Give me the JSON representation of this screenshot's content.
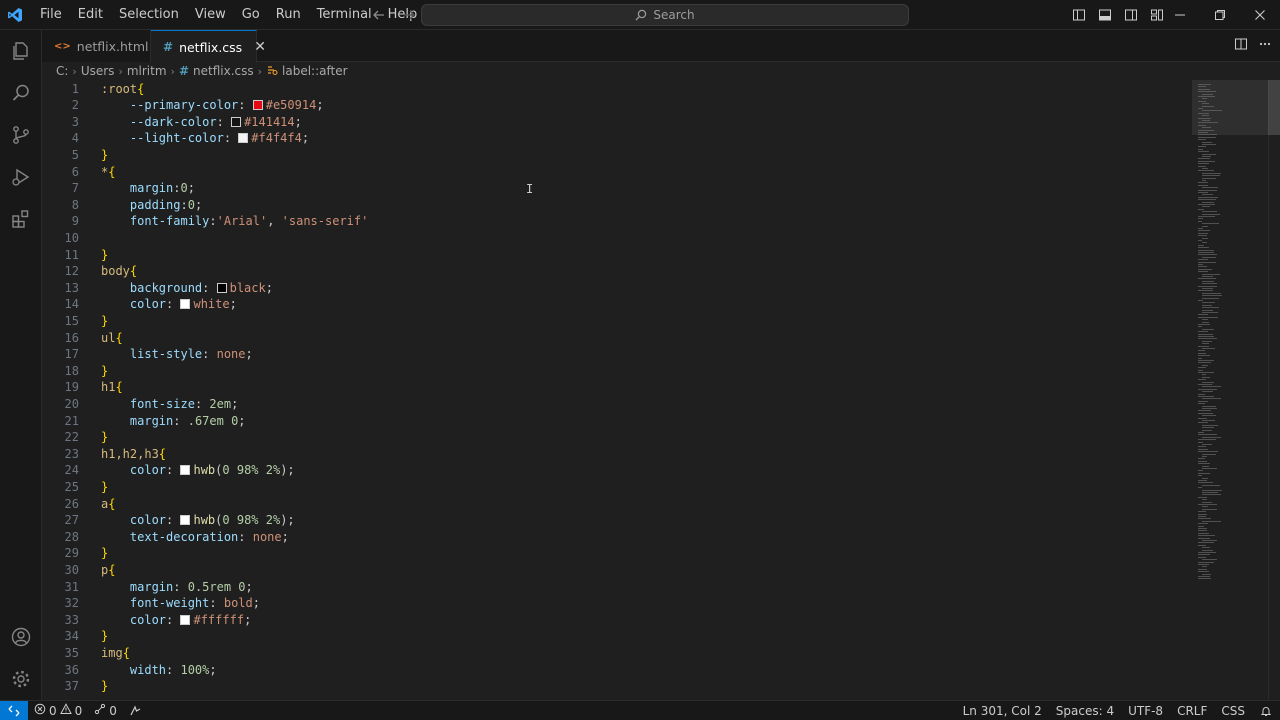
{
  "menu": [
    "File",
    "Edit",
    "Selection",
    "View",
    "Go",
    "Run",
    "Terminal",
    "Help"
  ],
  "search": {
    "label": "Search"
  },
  "tabs": [
    {
      "label": "netflix.html",
      "active": false
    },
    {
      "label": "netflix.css",
      "active": true
    }
  ],
  "breadcrumb": {
    "drive": "C:",
    "users": "Users",
    "user": "mlritm",
    "file": "netflix.css",
    "symbol": "label::after"
  },
  "code_lines": [
    {
      "n": "1",
      "tokens": [
        [
          "sel",
          ":root"
        ],
        [
          "brace",
          "{"
        ]
      ]
    },
    {
      "n": "2",
      "tokens": [
        [
          "sp",
          "    "
        ],
        [
          "var",
          "--primary-color"
        ],
        [
          "punc",
          ": "
        ],
        [
          "swatch",
          "#e50914"
        ],
        [
          "val",
          "#e50914"
        ],
        [
          "punc",
          ";"
        ]
      ]
    },
    {
      "n": "3",
      "tokens": [
        [
          "sp",
          "    "
        ],
        [
          "var",
          "--dark-color"
        ],
        [
          "punc",
          ": "
        ],
        [
          "swatch",
          "#141414"
        ],
        [
          "val",
          "#141414"
        ],
        [
          "punc",
          ";"
        ]
      ]
    },
    {
      "n": "4",
      "tokens": [
        [
          "sp",
          "    "
        ],
        [
          "var",
          "--light-color"
        ],
        [
          "punc",
          ": "
        ],
        [
          "swatch",
          "#f4f4f4"
        ],
        [
          "val",
          "#f4f4f4"
        ],
        [
          "punc",
          ";"
        ]
      ]
    },
    {
      "n": "5",
      "tokens": [
        [
          "brace",
          "}"
        ]
      ]
    },
    {
      "n": "6",
      "tokens": [
        [
          "sel",
          "*"
        ],
        [
          "brace",
          "{"
        ]
      ]
    },
    {
      "n": "7",
      "tokens": [
        [
          "sp",
          "    "
        ],
        [
          "prop",
          "margin"
        ],
        [
          "punc",
          ":"
        ],
        [
          "num",
          "0"
        ],
        [
          "punc",
          ";"
        ]
      ]
    },
    {
      "n": "8",
      "tokens": [
        [
          "sp",
          "    "
        ],
        [
          "prop",
          "padding"
        ],
        [
          "punc",
          ":"
        ],
        [
          "num",
          "0"
        ],
        [
          "punc",
          ";"
        ]
      ]
    },
    {
      "n": "9",
      "tokens": [
        [
          "sp",
          "    "
        ],
        [
          "prop",
          "font-family"
        ],
        [
          "punc",
          ":"
        ],
        [
          "val",
          "'Arial'"
        ],
        [
          "punc",
          ", "
        ],
        [
          "val",
          "'sans-serif'"
        ]
      ]
    },
    {
      "n": "10",
      "tokens": []
    },
    {
      "n": "11",
      "tokens": [
        [
          "brace",
          "}"
        ]
      ]
    },
    {
      "n": "12",
      "tokens": [
        [
          "sel",
          "body"
        ],
        [
          "brace",
          "{"
        ]
      ]
    },
    {
      "n": "13",
      "tokens": [
        [
          "sp",
          "    "
        ],
        [
          "prop",
          "background"
        ],
        [
          "punc",
          ": "
        ],
        [
          "swatch",
          "#000000"
        ],
        [
          "val",
          "black"
        ],
        [
          "punc",
          ";"
        ]
      ]
    },
    {
      "n": "14",
      "tokens": [
        [
          "sp",
          "    "
        ],
        [
          "prop",
          "color"
        ],
        [
          "punc",
          ": "
        ],
        [
          "swatch",
          "#ffffff"
        ],
        [
          "val",
          "white"
        ],
        [
          "punc",
          ";"
        ]
      ]
    },
    {
      "n": "15",
      "tokens": [
        [
          "brace",
          "}"
        ]
      ]
    },
    {
      "n": "16",
      "tokens": [
        [
          "sel",
          "ul"
        ],
        [
          "brace",
          "{"
        ]
      ]
    },
    {
      "n": "17",
      "tokens": [
        [
          "sp",
          "    "
        ],
        [
          "prop",
          "list-style"
        ],
        [
          "punc",
          ": "
        ],
        [
          "val",
          "none"
        ],
        [
          "punc",
          ";"
        ]
      ]
    },
    {
      "n": "18",
      "tokens": [
        [
          "brace",
          "}"
        ]
      ]
    },
    {
      "n": "19",
      "tokens": [
        [
          "sel",
          "h1"
        ],
        [
          "brace",
          "{"
        ]
      ]
    },
    {
      "n": "20",
      "tokens": [
        [
          "sp",
          "    "
        ],
        [
          "prop",
          "font-size"
        ],
        [
          "punc",
          ": "
        ],
        [
          "num",
          "2em"
        ],
        [
          "punc",
          ";"
        ]
      ]
    },
    {
      "n": "21",
      "tokens": [
        [
          "sp",
          "    "
        ],
        [
          "prop",
          "margin"
        ],
        [
          "punc",
          ": "
        ],
        [
          "num",
          ".67em 0"
        ],
        [
          "punc",
          ";"
        ]
      ]
    },
    {
      "n": "22",
      "tokens": [
        [
          "brace",
          "}"
        ]
      ]
    },
    {
      "n": "23",
      "tokens": [
        [
          "sel",
          "h1,h2,h3"
        ],
        [
          "brace",
          "{"
        ]
      ]
    },
    {
      "n": "24",
      "tokens": [
        [
          "sp",
          "    "
        ],
        [
          "prop",
          "color"
        ],
        [
          "punc",
          ": "
        ],
        [
          "swatch",
          "#ffffff"
        ],
        [
          "fn",
          "hwb"
        ],
        [
          "punc",
          "("
        ],
        [
          "num",
          "0 98% 2%"
        ],
        [
          "punc",
          ");"
        ]
      ]
    },
    {
      "n": "25",
      "tokens": [
        [
          "brace",
          "}"
        ]
      ]
    },
    {
      "n": "26",
      "tokens": [
        [
          "sel",
          "a"
        ],
        [
          "brace",
          "{"
        ]
      ]
    },
    {
      "n": "27",
      "tokens": [
        [
          "sp",
          "    "
        ],
        [
          "prop",
          "color"
        ],
        [
          "punc",
          ": "
        ],
        [
          "swatch",
          "#ffffff"
        ],
        [
          "fn",
          "hwb"
        ],
        [
          "punc",
          "("
        ],
        [
          "num",
          "0 98% 2%"
        ],
        [
          "punc",
          ");"
        ]
      ]
    },
    {
      "n": "28",
      "tokens": [
        [
          "sp",
          "    "
        ],
        [
          "prop",
          "text-decoration"
        ],
        [
          "punc",
          ": "
        ],
        [
          "val",
          "none"
        ],
        [
          "punc",
          ";"
        ]
      ]
    },
    {
      "n": "29",
      "tokens": [
        [
          "brace",
          "}"
        ]
      ]
    },
    {
      "n": "30",
      "tokens": [
        [
          "sel",
          "p"
        ],
        [
          "brace",
          "{"
        ]
      ]
    },
    {
      "n": "31",
      "tokens": [
        [
          "sp",
          "    "
        ],
        [
          "prop",
          "margin"
        ],
        [
          "punc",
          ": "
        ],
        [
          "num",
          "0.5rem 0"
        ],
        [
          "punc",
          ";"
        ]
      ]
    },
    {
      "n": "32",
      "tokens": [
        [
          "sp",
          "    "
        ],
        [
          "prop",
          "font-weight"
        ],
        [
          "punc",
          ": "
        ],
        [
          "val",
          "bold"
        ],
        [
          "punc",
          ";"
        ]
      ]
    },
    {
      "n": "33",
      "tokens": [
        [
          "sp",
          "    "
        ],
        [
          "prop",
          "color"
        ],
        [
          "punc",
          ": "
        ],
        [
          "swatch",
          "#ffffff"
        ],
        [
          "val",
          "#ffffff"
        ],
        [
          "punc",
          ";"
        ]
      ]
    },
    {
      "n": "34",
      "tokens": [
        [
          "brace",
          "}"
        ]
      ]
    },
    {
      "n": "35",
      "tokens": [
        [
          "sel",
          "img"
        ],
        [
          "brace",
          "{"
        ]
      ]
    },
    {
      "n": "36",
      "tokens": [
        [
          "sp",
          "    "
        ],
        [
          "prop",
          "width"
        ],
        [
          "punc",
          ": "
        ],
        [
          "num",
          "100%"
        ],
        [
          "punc",
          ";"
        ]
      ]
    },
    {
      "n": "37",
      "tokens": [
        [
          "brace",
          "}"
        ]
      ]
    }
  ],
  "status": {
    "errors": "0",
    "warnings": "0",
    "ports": "0",
    "position": "Ln 301, Col 2",
    "spaces": "Spaces: 4",
    "encoding": "UTF-8",
    "eol": "CRLF",
    "language": "CSS"
  },
  "colors": {
    "accent": "#0078d4",
    "editor_bg": "#1f1f1f",
    "chrome_bg": "#181818"
  }
}
